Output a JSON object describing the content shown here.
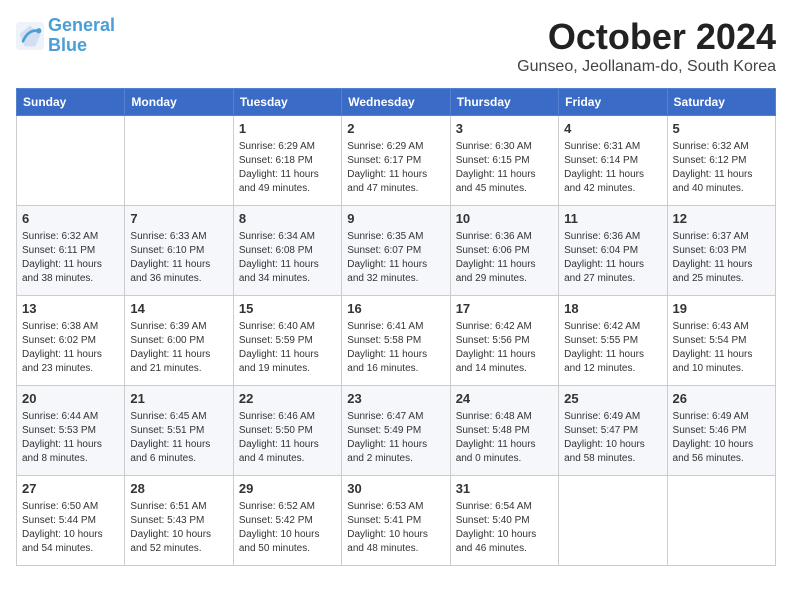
{
  "header": {
    "logo_line1": "General",
    "logo_line2": "Blue",
    "month": "October 2024",
    "location": "Gunseo, Jeollanam-do, South Korea"
  },
  "weekdays": [
    "Sunday",
    "Monday",
    "Tuesday",
    "Wednesday",
    "Thursday",
    "Friday",
    "Saturday"
  ],
  "weeks": [
    [
      {
        "day": "",
        "info": ""
      },
      {
        "day": "",
        "info": ""
      },
      {
        "day": "1",
        "info": "Sunrise: 6:29 AM\nSunset: 6:18 PM\nDaylight: 11 hours and 49 minutes."
      },
      {
        "day": "2",
        "info": "Sunrise: 6:29 AM\nSunset: 6:17 PM\nDaylight: 11 hours and 47 minutes."
      },
      {
        "day": "3",
        "info": "Sunrise: 6:30 AM\nSunset: 6:15 PM\nDaylight: 11 hours and 45 minutes."
      },
      {
        "day": "4",
        "info": "Sunrise: 6:31 AM\nSunset: 6:14 PM\nDaylight: 11 hours and 42 minutes."
      },
      {
        "day": "5",
        "info": "Sunrise: 6:32 AM\nSunset: 6:12 PM\nDaylight: 11 hours and 40 minutes."
      }
    ],
    [
      {
        "day": "6",
        "info": "Sunrise: 6:32 AM\nSunset: 6:11 PM\nDaylight: 11 hours and 38 minutes."
      },
      {
        "day": "7",
        "info": "Sunrise: 6:33 AM\nSunset: 6:10 PM\nDaylight: 11 hours and 36 minutes."
      },
      {
        "day": "8",
        "info": "Sunrise: 6:34 AM\nSunset: 6:08 PM\nDaylight: 11 hours and 34 minutes."
      },
      {
        "day": "9",
        "info": "Sunrise: 6:35 AM\nSunset: 6:07 PM\nDaylight: 11 hours and 32 minutes."
      },
      {
        "day": "10",
        "info": "Sunrise: 6:36 AM\nSunset: 6:06 PM\nDaylight: 11 hours and 29 minutes."
      },
      {
        "day": "11",
        "info": "Sunrise: 6:36 AM\nSunset: 6:04 PM\nDaylight: 11 hours and 27 minutes."
      },
      {
        "day": "12",
        "info": "Sunrise: 6:37 AM\nSunset: 6:03 PM\nDaylight: 11 hours and 25 minutes."
      }
    ],
    [
      {
        "day": "13",
        "info": "Sunrise: 6:38 AM\nSunset: 6:02 PM\nDaylight: 11 hours and 23 minutes."
      },
      {
        "day": "14",
        "info": "Sunrise: 6:39 AM\nSunset: 6:00 PM\nDaylight: 11 hours and 21 minutes."
      },
      {
        "day": "15",
        "info": "Sunrise: 6:40 AM\nSunset: 5:59 PM\nDaylight: 11 hours and 19 minutes."
      },
      {
        "day": "16",
        "info": "Sunrise: 6:41 AM\nSunset: 5:58 PM\nDaylight: 11 hours and 16 minutes."
      },
      {
        "day": "17",
        "info": "Sunrise: 6:42 AM\nSunset: 5:56 PM\nDaylight: 11 hours and 14 minutes."
      },
      {
        "day": "18",
        "info": "Sunrise: 6:42 AM\nSunset: 5:55 PM\nDaylight: 11 hours and 12 minutes."
      },
      {
        "day": "19",
        "info": "Sunrise: 6:43 AM\nSunset: 5:54 PM\nDaylight: 11 hours and 10 minutes."
      }
    ],
    [
      {
        "day": "20",
        "info": "Sunrise: 6:44 AM\nSunset: 5:53 PM\nDaylight: 11 hours and 8 minutes."
      },
      {
        "day": "21",
        "info": "Sunrise: 6:45 AM\nSunset: 5:51 PM\nDaylight: 11 hours and 6 minutes."
      },
      {
        "day": "22",
        "info": "Sunrise: 6:46 AM\nSunset: 5:50 PM\nDaylight: 11 hours and 4 minutes."
      },
      {
        "day": "23",
        "info": "Sunrise: 6:47 AM\nSunset: 5:49 PM\nDaylight: 11 hours and 2 minutes."
      },
      {
        "day": "24",
        "info": "Sunrise: 6:48 AM\nSunset: 5:48 PM\nDaylight: 11 hours and 0 minutes."
      },
      {
        "day": "25",
        "info": "Sunrise: 6:49 AM\nSunset: 5:47 PM\nDaylight: 10 hours and 58 minutes."
      },
      {
        "day": "26",
        "info": "Sunrise: 6:49 AM\nSunset: 5:46 PM\nDaylight: 10 hours and 56 minutes."
      }
    ],
    [
      {
        "day": "27",
        "info": "Sunrise: 6:50 AM\nSunset: 5:44 PM\nDaylight: 10 hours and 54 minutes."
      },
      {
        "day": "28",
        "info": "Sunrise: 6:51 AM\nSunset: 5:43 PM\nDaylight: 10 hours and 52 minutes."
      },
      {
        "day": "29",
        "info": "Sunrise: 6:52 AM\nSunset: 5:42 PM\nDaylight: 10 hours and 50 minutes."
      },
      {
        "day": "30",
        "info": "Sunrise: 6:53 AM\nSunset: 5:41 PM\nDaylight: 10 hours and 48 minutes."
      },
      {
        "day": "31",
        "info": "Sunrise: 6:54 AM\nSunset: 5:40 PM\nDaylight: 10 hours and 46 minutes."
      },
      {
        "day": "",
        "info": ""
      },
      {
        "day": "",
        "info": ""
      }
    ]
  ]
}
